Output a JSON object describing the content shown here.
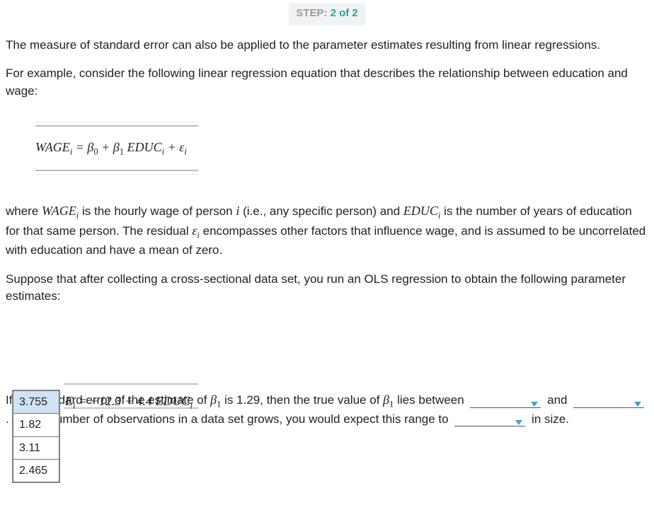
{
  "step": {
    "prefix": "STEP: ",
    "current": "2 of 2"
  },
  "para1": "The measure of standard error can also be applied to the parameter estimates resulting from linear regressions.",
  "para2": "For example, consider the following linear regression equation that describes the relationship between education and wage:",
  "equation1_html": "WAGEᵢ = β0 + β1 EDUCᵢ + εᵢ",
  "explain1_a": "where ",
  "explain1_b": " is the hourly wage of person ",
  "explain1_c": " (i.e., any specific person) and ",
  "explain1_d": " is the number of years of education for that same person. The residual ",
  "explain1_e": " encompasses other factors that influence wage, and is assumed to be uncorrelated with education and have a mean of zero.",
  "var_wage": "WAGE",
  "var_educ": "EDUC",
  "var_i": "i",
  "var_eps": "ε",
  "para3": "Suppose that after collecting a cross-sectional data set, you run an OLS regression to obtain the following parameter estimates:",
  "dropdown": {
    "options": [
      "3.755",
      "1.82",
      "3.11",
      "2.465"
    ],
    "selected_index": 0
  },
  "equation2_lhs": "E",
  "equation2_rhs": " = −12.3 + 4.4 EDUC",
  "fill": {
    "lead": "If the standard error of the estimate of ",
    "beta1": "β",
    "beta1_sub": "1",
    "mid1": " is 1.29, then the true value of ",
    "mid2": " lies between ",
    "and": " and ",
    "mid3": " . As the number of observations in a data set grows, you would expect this range to ",
    "tail": " in size."
  }
}
